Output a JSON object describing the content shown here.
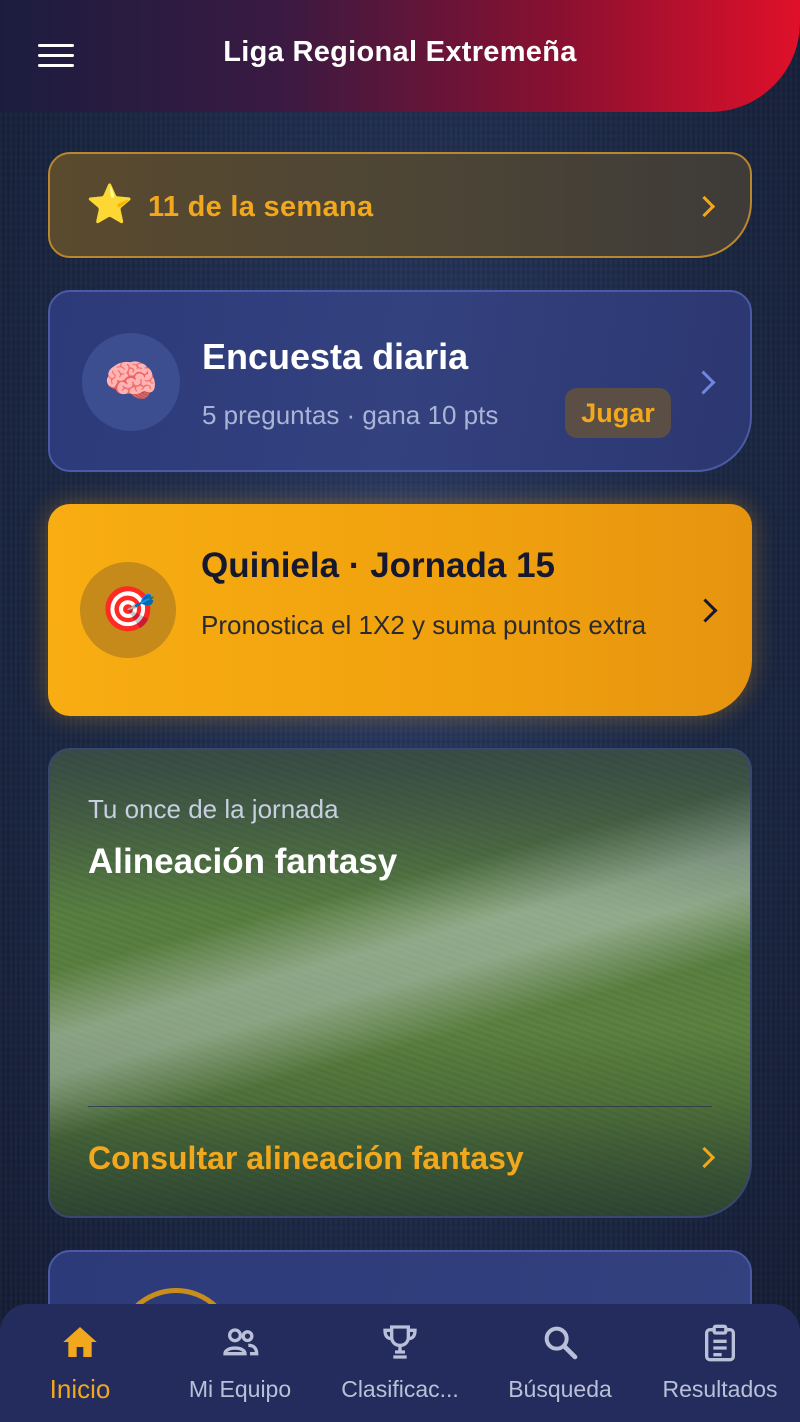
{
  "header": {
    "title": "Liga Regional Extremeña",
    "menu_icon": "hamburger-menu-icon"
  },
  "cards": {
    "week": {
      "icon": "star-icon",
      "icon_glyph": "⭐",
      "label": "11 de la semana"
    },
    "quiz": {
      "icon": "brain-icon",
      "icon_glyph": "🧠",
      "title": "Encuesta diaria",
      "subtitle": "5 preguntas · gana 10 pts",
      "button_label": "Jugar"
    },
    "quiniela": {
      "icon": "target-icon",
      "icon_glyph": "🎯",
      "title": "Quiniela · Jornada 15",
      "subtitle": "Pronostica el 1X2 y suma puntos extra"
    },
    "fantasy": {
      "kicker": "Tu once de la jornada",
      "title": "Alineación fantasy",
      "link_label": "Consultar alineación fantasy"
    }
  },
  "bottom_nav": {
    "items": [
      {
        "label": "Inicio",
        "icon": "home-icon",
        "active": true
      },
      {
        "label": "Mi Equipo",
        "icon": "team-icon",
        "active": false
      },
      {
        "label": "Clasificac...",
        "icon": "trophy-icon",
        "active": false
      },
      {
        "label": "Búsqueda",
        "icon": "search-icon",
        "active": false
      },
      {
        "label": "Resultados",
        "icon": "clipboard-icon",
        "active": false
      }
    ]
  },
  "colors": {
    "accent": "#f2a81c",
    "header_red": "#e0102a",
    "nav_bg": "#232c5c"
  }
}
